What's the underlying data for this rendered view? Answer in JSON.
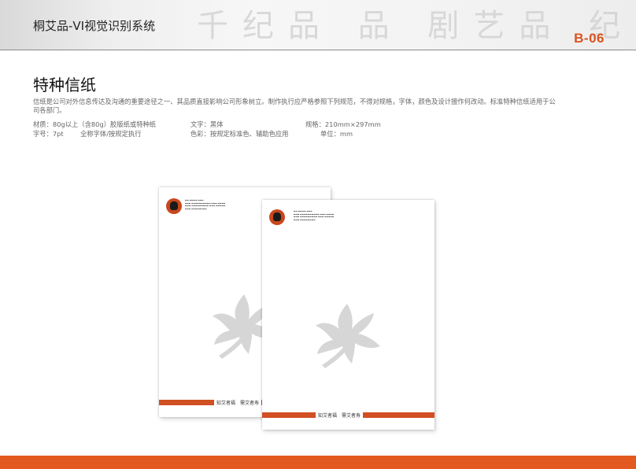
{
  "header": {
    "title": "桐艾品-VI视觉识别系统",
    "page_code": "B-06"
  },
  "main": {
    "heading": "特种信纸",
    "description": "信纸是公司对外信息传达及沟通的重要途径之一、其品质直接影响公司形象树立。制作执行应严格参照下列规范，不得对规格，字体，颜色及设计擅作何改动。标准特种信纸适用于公司各部门。",
    "specs": {
      "material": "材质：80g以上（含80g）胶版纸或特种纸",
      "font_label": "文字：黑体",
      "size": "规格：210mm×297mm",
      "font_size": "字号：7pt",
      "font_rule": "全称字体/按规定执行",
      "color": "色彩：按规定标准色、辅助色应用",
      "unit": "单位：mm"
    }
  },
  "letterhead": {
    "footer_text": "知艾者福　需艾者寿"
  },
  "colors": {
    "accent": "#e25a1f",
    "brand_red": "#d14f22",
    "logo": "#c8471d"
  }
}
